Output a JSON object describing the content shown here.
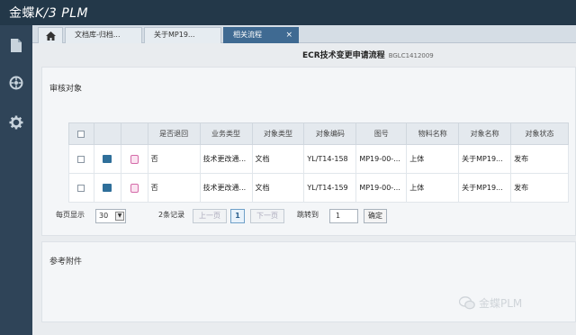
{
  "app": {
    "logo_cn": "金蝶",
    "logo_k3": "K/3",
    "logo_plm": "PLM"
  },
  "rail": {
    "icons": [
      "document-icon",
      "compass-icon",
      "gear-icon"
    ]
  },
  "tabs": [
    {
      "label": "文档库-归档..."
    },
    {
      "label": "关于MP19..."
    },
    {
      "label": "相关流程",
      "close": "×"
    }
  ],
  "page": {
    "title": "ECR技术变更申请流程",
    "code": "BGLC1412009"
  },
  "review": {
    "title": "审核对象",
    "columns": [
      "是否退回",
      "业务类型",
      "对象类型",
      "对象编码",
      "图号",
      "物料名称",
      "对象名称",
      "对象状态"
    ],
    "rows": [
      [
        "否",
        "技术更改通...",
        "文档",
        "YL/T14-158",
        "MP19-00-...",
        "上体",
        "关于MP19...",
        "发布"
      ],
      [
        "否",
        "技术更改通...",
        "文档",
        "YL/T14-159",
        "MP19-00-...",
        "上体",
        "关于MP19...",
        "发布"
      ]
    ]
  },
  "pager": {
    "per_page_label": "每页显示",
    "per_page_value": "30",
    "records": "2条记录",
    "prev": "上一页",
    "current": "1",
    "next": "下一页",
    "jump_label": "跳转到",
    "jump_value": "1",
    "go": "确定"
  },
  "attachments": {
    "title": "参考附件"
  },
  "watermark": {
    "text": "金蝶PLM"
  }
}
